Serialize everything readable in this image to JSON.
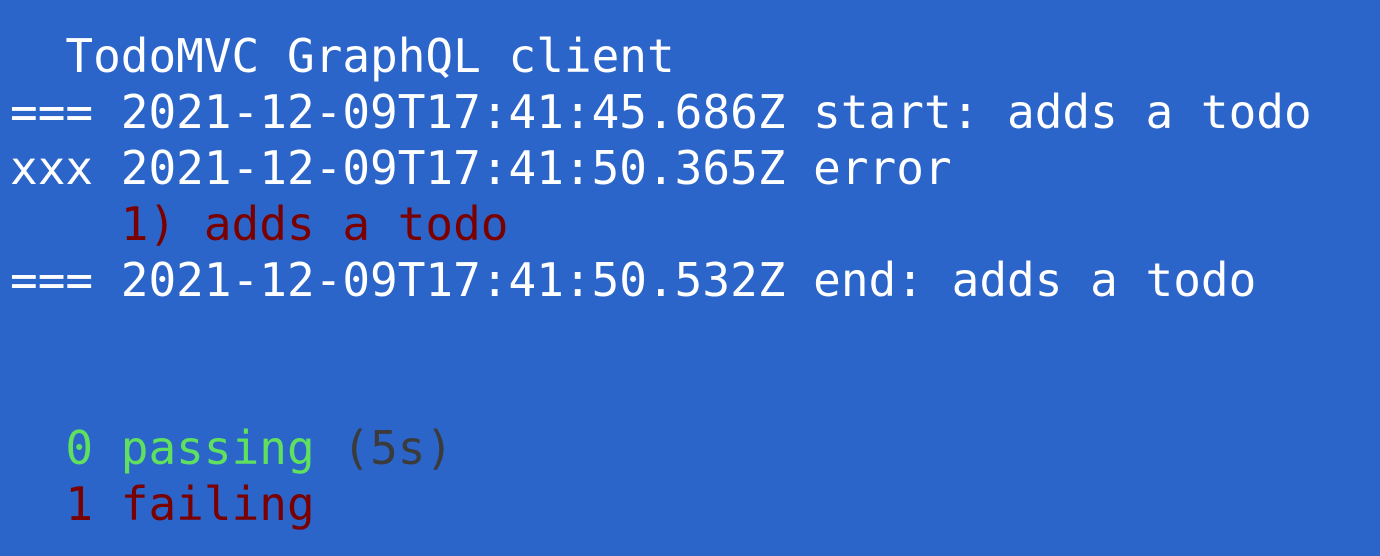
{
  "suite_title": "TodoMVC GraphQL client",
  "log": [
    {
      "prefix": "===",
      "timestamp": "2021-12-09T17:41:45.686Z",
      "message": "start: adds a todo"
    },
    {
      "prefix": "xxx",
      "timestamp": "2021-12-09T17:41:50.365Z",
      "message": "error"
    },
    {
      "prefix": "===",
      "timestamp": "2021-12-09T17:41:50.532Z",
      "message": "end: adds a todo"
    }
  ],
  "failure": {
    "label": "1) adds a todo"
  },
  "summary": {
    "passing_count": "0",
    "passing_label": "passing",
    "duration": "(5s)",
    "failing_count": "1",
    "failing_label": "failing"
  },
  "colors": {
    "background": "#2c65c9",
    "text": "#ffffff",
    "error": "#7a0000",
    "passing": "#5fe05f",
    "muted": "#3b3b3b"
  }
}
